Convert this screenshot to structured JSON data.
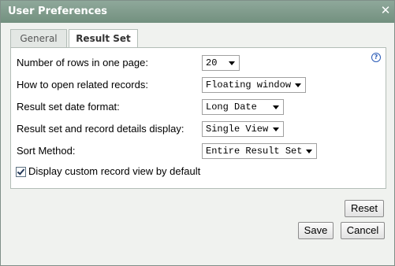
{
  "dialog": {
    "title": "User Preferences",
    "close_glyph": "✕"
  },
  "tabs": [
    {
      "label": "General",
      "active": false
    },
    {
      "label": "Result Set",
      "active": true
    }
  ],
  "help_glyph": "?",
  "settings": [
    {
      "label": "Number of rows in one page:",
      "value": "20"
    },
    {
      "label": "How to open related records:",
      "value": "Floating window"
    },
    {
      "label": "Result set date format:",
      "value": "Long Date"
    },
    {
      "label": "Result set and record details display:",
      "value": "Single View"
    },
    {
      "label": "Sort Method:",
      "value": "Entire Result Set"
    }
  ],
  "checkbox": {
    "label": "Display custom record view by default",
    "checked": true
  },
  "buttons": {
    "reset": "Reset",
    "save": "Save",
    "cancel": "Cancel"
  },
  "colors": {
    "titlebar": "#7f9b8b",
    "dialog_bg": "#f0f2ef",
    "panel_bg": "#ffffff"
  }
}
